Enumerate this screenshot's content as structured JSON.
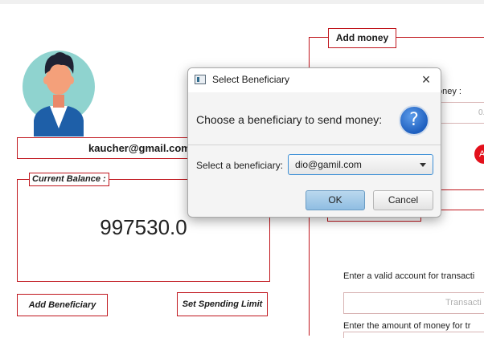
{
  "user": {
    "email": "kaucher@gmail.com"
  },
  "balance": {
    "label": "Current Balance :",
    "value": "997530.0"
  },
  "left_buttons": {
    "add_beneficiary": "Add Beneficiary",
    "set_spending_limit": "Set Spending Limit"
  },
  "add_money": {
    "title": "Add money",
    "money_label": "oney :",
    "money_field_value": "0.",
    "badge_text": "A",
    "account_hint": "Enter a valid account for transacti",
    "account_placeholder": "Transacti",
    "amount_hint": "Enter the amount of money for tr"
  },
  "dialog": {
    "title": "Select Beneficiary",
    "close_symbol": "×",
    "message": "Choose a beneficiary to send money:",
    "question_symbol": "?",
    "field_label": "Select a beneficiary:",
    "selected_beneficiary": "dio@gamil.com",
    "ok_label": "OK",
    "cancel_label": "Cancel"
  },
  "colors": {
    "accent_border": "#c0161d",
    "avatar_bg": "#8fd3cf",
    "dialog_icon_blue": "#1e5fbf"
  },
  "icons": [
    "user-avatar-icon",
    "app-window-icon",
    "close-icon",
    "question-icon",
    "chevron-down-icon"
  ]
}
